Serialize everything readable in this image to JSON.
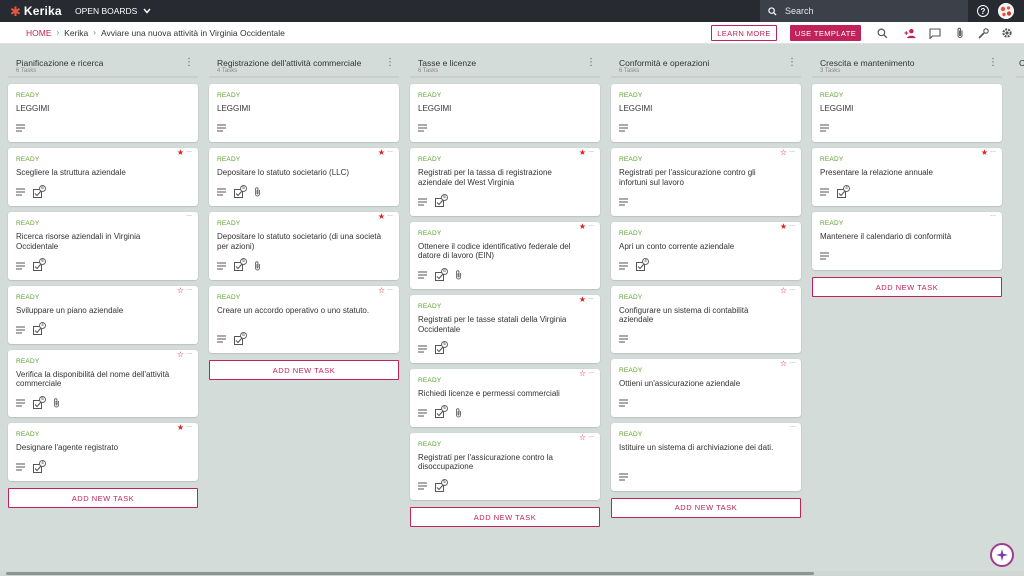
{
  "app": {
    "logo_text": "Kerika"
  },
  "topbar": {
    "open_boards": "OPEN BOARDS",
    "search_placeholder": "Search",
    "help": "?"
  },
  "breadcrumb": {
    "home": "HOME",
    "account": "Kerika",
    "board": "Avviare una nuova attività in Virginia Occidentale"
  },
  "buttons": {
    "learn_more": "LEARN MORE",
    "use_template": "USE TEMPLATE"
  },
  "colors": {
    "accent": "#c1225a",
    "topbar": "#272a31",
    "ready": "#5aa12a",
    "star": "#e02020"
  },
  "icons": [
    "search-icon",
    "add-person-icon",
    "chat-icon",
    "attachment-icon",
    "tools-icon",
    "settings-icon"
  ],
  "add_task_label": "ADD NEW TASK",
  "columns": [
    {
      "title": "Pianificazione e ricerca",
      "count": "6 Tasks",
      "cards": [
        {
          "status": "READY",
          "title": "LEGGIMI",
          "star": "none",
          "checklist": null,
          "attachment": false
        },
        {
          "status": "READY",
          "title": "Scegliere la struttura aziendale",
          "star": "filled",
          "checklist": "6",
          "attachment": false
        },
        {
          "status": "READY",
          "title": "Ricerca risorse aziendali in Virginia Occidentale",
          "star": "none",
          "checklist": "5",
          "attachment": false
        },
        {
          "status": "READY",
          "title": "Sviluppare un piano aziendale",
          "star": "outline",
          "checklist": "4",
          "attachment": false
        },
        {
          "status": "READY",
          "title": "Verifica la disponibilità del nome dell'attività commerciale",
          "star": "outline",
          "checklist": "5",
          "attachment": true
        },
        {
          "status": "READY",
          "title": "Designare l'agente registrato",
          "star": "filled",
          "checklist": "4",
          "attachment": false
        }
      ]
    },
    {
      "title": "Registrazione dell'attività commerciale",
      "count": "4 Tasks",
      "cards": [
        {
          "status": "READY",
          "title": "LEGGIMI",
          "star": "none",
          "checklist": null,
          "attachment": false
        },
        {
          "status": "READY",
          "title": "Depositare lo statuto societario (LLC)",
          "star": "filled",
          "checklist": "5",
          "attachment": true
        },
        {
          "status": "READY",
          "title": "Depositare lo statuto societario (di una società per azioni)",
          "star": "filled",
          "checklist": "5",
          "attachment": true
        },
        {
          "status": "READY",
          "title": "Creare un accordo operativo o uno statuto.",
          "star": "outline",
          "checklist": "6",
          "attachment": false
        }
      ]
    },
    {
      "title": "Tasse e licenze",
      "count": "6 Tasks",
      "cards": [
        {
          "status": "READY",
          "title": "LEGGIMI",
          "star": "none",
          "checklist": null,
          "attachment": false
        },
        {
          "status": "READY",
          "title": "Registrati per la tassa di registrazione aziendale del West Virginia",
          "star": "filled",
          "checklist": "5",
          "attachment": false
        },
        {
          "status": "READY",
          "title": "Ottenere il codice identificativo federale del datore di lavoro (EIN)",
          "star": "filled",
          "checklist": "6",
          "attachment": true
        },
        {
          "status": "READY",
          "title": "Registrati per le tasse statali della Virginia Occidentale",
          "star": "filled",
          "checklist": "5",
          "attachment": false
        },
        {
          "status": "READY",
          "title": "Richiedi licenze e permessi commerciali",
          "star": "outline",
          "checklist": "5",
          "attachment": true
        },
        {
          "status": "READY",
          "title": "Registrati per l'assicurazione contro la disoccupazione",
          "star": "outline",
          "checklist": "5",
          "attachment": false
        }
      ]
    },
    {
      "title": "Conformità e operazioni",
      "count": "6 Tasks",
      "cards": [
        {
          "status": "READY",
          "title": "LEGGIMI",
          "star": "none",
          "checklist": null,
          "attachment": false
        },
        {
          "status": "READY",
          "title": "Registrati per l'assicurazione contro gli infortuni sul lavoro",
          "star": "outline",
          "checklist": null,
          "attachment": false
        },
        {
          "status": "READY",
          "title": "Apri un conto corrente aziendale",
          "star": "filled",
          "checklist": "4",
          "attachment": false
        },
        {
          "status": "READY",
          "title": "Configurare un sistema di contabilità aziendale",
          "star": "outline",
          "checklist": null,
          "attachment": false
        },
        {
          "status": "READY",
          "title": "Ottieni un'assicurazione aziendale",
          "star": "outline",
          "checklist": null,
          "attachment": false
        },
        {
          "status": "READY",
          "title": "Istituire un sistema di archiviazione dei dati.",
          "star": "none",
          "checklist": null,
          "attachment": false
        }
      ]
    },
    {
      "title": "Crescita e mantenimento",
      "count": "3 Tasks",
      "cards": [
        {
          "status": "READY",
          "title": "LEGGIMI",
          "star": "none",
          "checklist": null,
          "attachment": false
        },
        {
          "status": "READY",
          "title": "Presentare la relazione annuale",
          "star": "filled",
          "checklist": "4",
          "attachment": false
        },
        {
          "status": "READY",
          "title": "Mantenere il calendario di conformità",
          "star": "none",
          "checklist": null,
          "attachment": false
        }
      ]
    }
  ],
  "partial_column_initial": "C"
}
